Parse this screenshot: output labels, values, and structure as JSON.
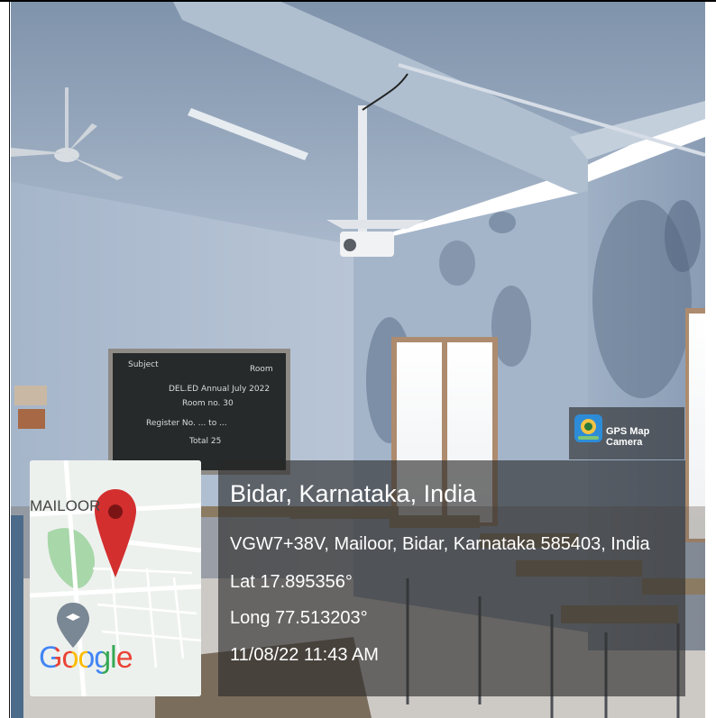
{
  "map": {
    "place_label": "MAILOOR",
    "google_logo": "Google"
  },
  "info": {
    "title": "Bidar, Karnataka, India",
    "address": "VGW7+38V, Mailoor, Bidar, Karnataka 585403, India",
    "lat": "Lat 17.895356°",
    "long": "Long 77.513203°",
    "datetime": "11/08/22 11:43 AM"
  },
  "badge": {
    "app_name": "GPS Map Camera",
    "icon": "gps-map-camera-icon"
  },
  "blackboard": {
    "lines": [
      "DEL.ED Annual July 2022",
      "Room no. 30",
      "Register No. ... to ...",
      "Total 25"
    ]
  },
  "colors": {
    "map_pin": "#d32f2f",
    "overlay": "#282828",
    "google_blue": "#4285F4",
    "google_red": "#EA4335",
    "google_yellow": "#FBBC05",
    "google_green": "#34A853"
  }
}
